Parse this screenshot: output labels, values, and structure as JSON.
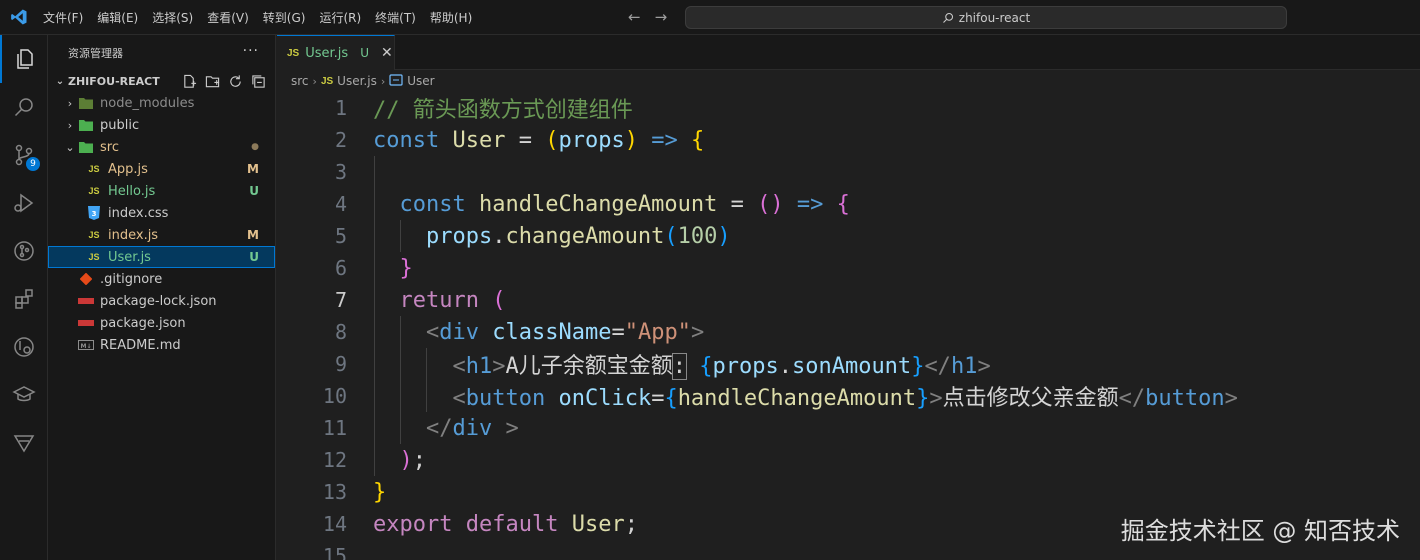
{
  "titlebar": {
    "menu": [
      "文件(F)",
      "编辑(E)",
      "选择(S)",
      "查看(V)",
      "转到(G)",
      "运行(R)",
      "终端(T)",
      "帮助(H)"
    ],
    "search": "zhifou-react"
  },
  "activity": {
    "scm_badge": "9"
  },
  "sidebar": {
    "title": "资源管理器",
    "more": "···",
    "root": "ZHIFOU-REACT",
    "items": [
      {
        "label": "node_modules",
        "status": ""
      },
      {
        "label": "public",
        "status": ""
      },
      {
        "label": "src",
        "status": "●"
      },
      {
        "label": "App.js",
        "status": "M"
      },
      {
        "label": "Hello.js",
        "status": "U"
      },
      {
        "label": "index.css",
        "status": ""
      },
      {
        "label": "index.js",
        "status": "M"
      },
      {
        "label": "User.js",
        "status": "U"
      },
      {
        "label": ".gitignore",
        "status": ""
      },
      {
        "label": "package-lock.json",
        "status": ""
      },
      {
        "label": "package.json",
        "status": ""
      },
      {
        "label": "README.md",
        "status": ""
      }
    ]
  },
  "tab": {
    "label": "User.js",
    "status": "U",
    "icon": "JS"
  },
  "breadcrumb": {
    "folder": "src",
    "file": "User.js",
    "symbol": "User"
  },
  "editor": {
    "line_numbers": [
      "1",
      "2",
      "3",
      "4",
      "5",
      "6",
      "7",
      "8",
      "9",
      "10",
      "11",
      "12",
      "13",
      "14",
      "15"
    ],
    "l1": "// 箭头函数方式创建组件",
    "l2_kw": "const",
    "l2_name": "User",
    "l2_eq": "=",
    "l2_open": "(",
    "l2_param": "props",
    "l2_close": ")",
    "l2_arrow": "=>",
    "l2_brace": "{",
    "l4_kw": "const",
    "l4_name": "handleChangeAmount",
    "l4_eq": "=",
    "l4_parens": "()",
    "l4_arrow": "=>",
    "l4_brace": "{",
    "l5_obj": "props",
    "l5_dot": ".",
    "l5_fn": "changeAmount",
    "l5_open": "(",
    "l5_num": "100",
    "l5_close": ")",
    "l6": "}",
    "l7_kw": "return",
    "l7_paren": "(",
    "l8_lt": "<",
    "l8_tag": "div",
    "l8_attr": "className",
    "l8_eq": "=",
    "l8_str": "\"App\"",
    "l8_gt": ">",
    "l9_lt": "<",
    "l9_tag": "h1",
    "l9_gt": ">",
    "l9_text": "A儿子余额宝金额",
    "l9_colon": ":",
    "l9_ob": "{",
    "l9_obj": "props",
    "l9_dot": ".",
    "l9_prop": "sonAmount",
    "l9_cb": "}",
    "l9_close_lt": "</",
    "l9_close_tag": "h1",
    "l9_close_gt": ">",
    "l10_lt": "<",
    "l10_tag": "button",
    "l10_attr": "onClick",
    "l10_eq": "=",
    "l10_ob": "{",
    "l10_val": "handleChangeAmount",
    "l10_cb": "}",
    "l10_gt": ">",
    "l10_text": "点击修改父亲金额",
    "l10_close_lt": "</",
    "l10_close_tag": "button",
    "l10_close_gt": ">",
    "l11_lt": "</",
    "l11_tag": "div",
    "l11_gt": " >",
    "l12": ");",
    "l13": "}",
    "l14_kw1": "export",
    "l14_kw2": "default",
    "l14_name": "User",
    "l14_semi": ";"
  },
  "watermark": "掘金技术社区 @ 知否技术"
}
